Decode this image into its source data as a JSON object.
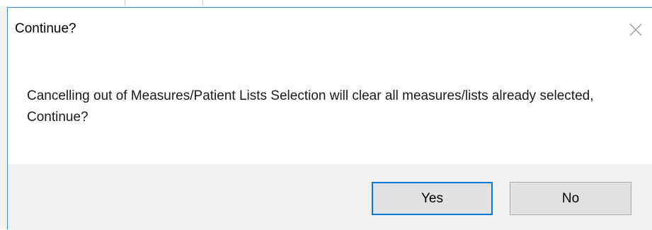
{
  "dialog": {
    "title": "Continue?",
    "message": "Cancelling out of Measures/Patient Lists Selection will clear all measures/lists already selected, Continue?",
    "buttons": {
      "yes_label": "Yes",
      "no_label": "No"
    },
    "close_icon": "close-icon"
  },
  "colors": {
    "accent_border": "#0078d7",
    "window_border": "#3b8fd1",
    "footer_bg": "#f0f0f0",
    "button_bg": "#e1e1e1"
  }
}
